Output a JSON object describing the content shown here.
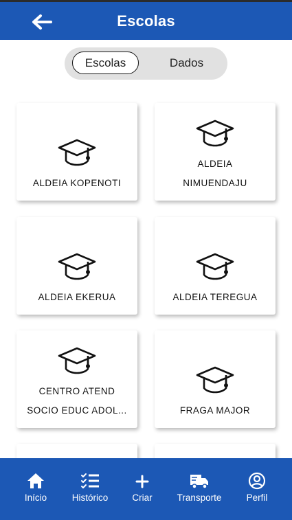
{
  "header": {
    "title": "Escolas",
    "back_icon": "arrow-left-icon"
  },
  "segment": {
    "options": [
      "Escolas",
      "Dados"
    ],
    "selected": "Escolas"
  },
  "schools": [
    {
      "lines": [
        "ALDEIA KOPENOTI"
      ]
    },
    {
      "lines": [
        "ALDEIA",
        "NIMUENDAJU"
      ]
    },
    {
      "lines": [
        "ALDEIA EKERUA"
      ]
    },
    {
      "lines": [
        "ALDEIA TEREGUA"
      ]
    },
    {
      "lines": [
        "CENTRO ATEND",
        "SOCIO EDUC ADOL..."
      ]
    },
    {
      "lines": [
        "FRAGA MAJOR"
      ]
    }
  ],
  "school_icon": "graduation-cap-icon",
  "bottom_nav": [
    {
      "label": "Início",
      "icon": "home-icon"
    },
    {
      "label": "Histórico",
      "icon": "checklist-icon"
    },
    {
      "label": "Criar",
      "icon": "plus-icon"
    },
    {
      "label": "Transporte",
      "icon": "truck-icon"
    },
    {
      "label": "Perfil",
      "icon": "user-circle-icon"
    }
  ],
  "colors": {
    "primary": "#1c58b5",
    "segment_bg": "#e1e1e1"
  }
}
